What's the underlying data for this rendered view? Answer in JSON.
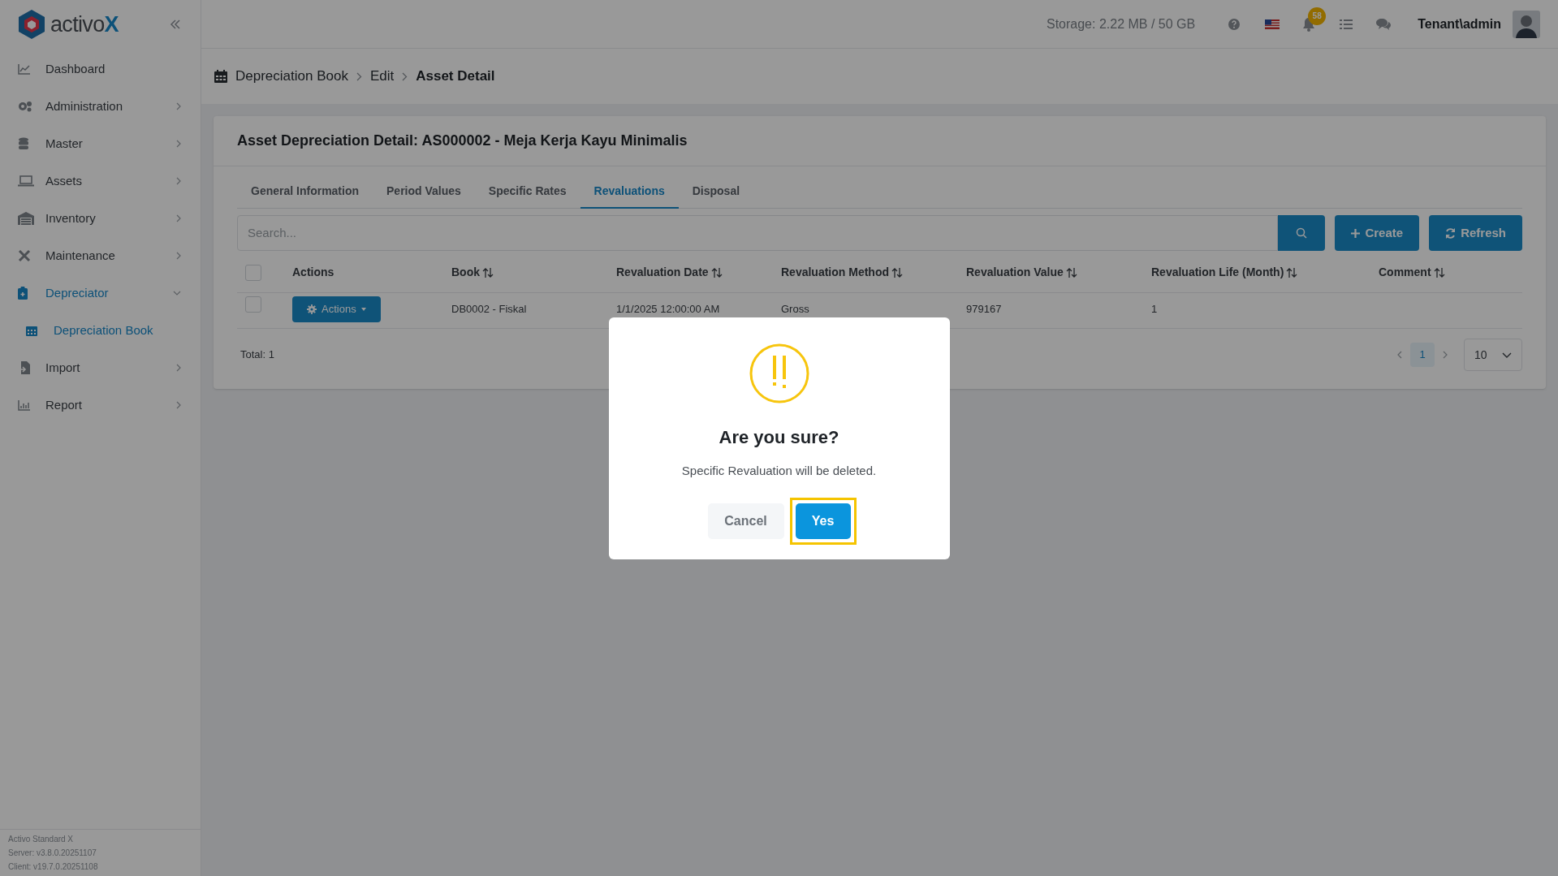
{
  "header": {
    "logo_text": "activo",
    "logo_accent": "X",
    "storage": "Storage: 2.22 MB / 50 GB",
    "notification_count": "58",
    "user": "Tenant\\admin"
  },
  "sidebar": {
    "items": [
      {
        "label": "Dashboard",
        "kind": "link",
        "selected": false
      },
      {
        "label": "Administration",
        "kind": "group",
        "expanded": false,
        "selected": false
      },
      {
        "label": "Master",
        "kind": "group",
        "expanded": false,
        "selected": false
      },
      {
        "label": "Assets",
        "kind": "group",
        "expanded": false,
        "selected": false
      },
      {
        "label": "Inventory",
        "kind": "group",
        "expanded": false,
        "selected": false
      },
      {
        "label": "Maintenance",
        "kind": "group",
        "expanded": false,
        "selected": false
      },
      {
        "label": "Depreciator",
        "kind": "group",
        "expanded": true,
        "selected": true,
        "children": [
          {
            "label": "Depreciation Book",
            "selected": true
          }
        ]
      },
      {
        "label": "Import",
        "kind": "group",
        "expanded": false,
        "selected": false
      },
      {
        "label": "Report",
        "kind": "group",
        "expanded": false,
        "selected": false
      }
    ],
    "footer": [
      "Activo Standard X",
      "Server: v3.8.0.20251107",
      "Client: v19.7.0.20251108"
    ]
  },
  "breadcrumb": [
    "Depreciation Book",
    "Edit",
    "Asset Detail"
  ],
  "card": {
    "title": "Asset Depreciation Detail: AS000002 - Meja Kerja Kayu Minimalis",
    "tabs": [
      {
        "label": "General Information",
        "selected": false
      },
      {
        "label": "Period Values",
        "selected": false
      },
      {
        "label": "Specific Rates",
        "selected": false
      },
      {
        "label": "Revaluations",
        "selected": true
      },
      {
        "label": "Disposal",
        "selected": false
      }
    ],
    "search": {
      "placeholder": "Search..."
    },
    "buttons": [
      {
        "label": "Create",
        "kind": "create"
      },
      {
        "label": "Refresh",
        "kind": "refresh"
      }
    ],
    "table": {
      "select_all_checked": false,
      "columns": [
        {
          "label": "Actions",
          "sortable": false
        },
        {
          "label": "Book",
          "sortable": true
        },
        {
          "label": "Revaluation Date",
          "sortable": true
        },
        {
          "label": "Revaluation Method",
          "sortable": true
        },
        {
          "label": "Revaluation Value",
          "sortable": true
        },
        {
          "label": "Revaluation Life (Month)",
          "sortable": true
        },
        {
          "label": "Comment",
          "sortable": true
        }
      ],
      "rows": [
        {
          "checked": false,
          "cells": [
            {
              "kind": "button",
              "text": "Actions"
            },
            {
              "kind": "text",
              "text": "DB0002 - Fiskal"
            },
            {
              "kind": "text",
              "text": "1/1/2025 12:00:00 AM"
            },
            {
              "kind": "text",
              "text": "Gross"
            },
            {
              "kind": "text",
              "text": "979167"
            },
            {
              "kind": "text",
              "text": "1"
            }
          ]
        }
      ]
    },
    "total": "Total: 1",
    "pagination": {
      "pages": [
        {
          "label": "1",
          "selected": true
        }
      ],
      "page_size": "10"
    }
  },
  "dialog": {
    "title": "Are you sure?",
    "message": "Specific Revaluation will be deleted.",
    "buttons": [
      {
        "label": "Cancel",
        "kind": "secondary",
        "highlighted": false
      },
      {
        "label": "Yes",
        "kind": "primary",
        "highlighted": true
      }
    ]
  }
}
